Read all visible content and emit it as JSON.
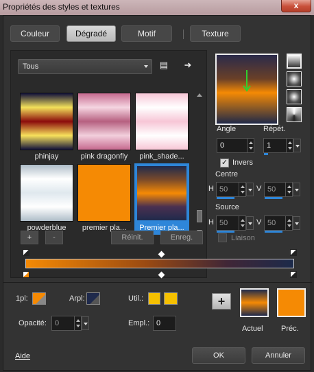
{
  "window": {
    "title": "Propriétés des styles et textures",
    "close": "x"
  },
  "tabs": [
    {
      "label": "Couleur",
      "active": false
    },
    {
      "label": "Dégradé",
      "active": true
    },
    {
      "label": "Motif",
      "active": false
    },
    {
      "label": "Texture",
      "active": false
    }
  ],
  "filter": {
    "value": "Tous"
  },
  "icons": {
    "library": "library-icon",
    "arrow": "arrow-right-icon"
  },
  "gradients": [
    {
      "name": "phinjay",
      "selected": false,
      "colors": [
        "#11113a",
        "#f3e05a",
        "#8b0b0b",
        "#f7e15c",
        "#11113a"
      ]
    },
    {
      "name": "pink dragonfly",
      "selected": false,
      "colors": [
        "#c66a8f",
        "#f5d5e1",
        "#b66080",
        "#f2cfdc",
        "#c66a8f"
      ]
    },
    {
      "name": "pink_shade...",
      "selected": false,
      "colors": [
        "#f7c6d6",
        "#ffffff",
        "#f7c6d6",
        "#ffffff",
        "#f7c6d6"
      ]
    },
    {
      "name": "powderblue",
      "selected": false,
      "colors": [
        "#aebdc8",
        "#ffffff",
        "#dfe8ee",
        "#ffffff",
        "#aebdc8"
      ]
    },
    {
      "name": "premier pla...",
      "selected": false,
      "colors": [
        "#f58a04",
        "#f58a04",
        "#f58a04",
        "#f58a04",
        "#f58a04"
      ]
    },
    {
      "name": "Premier pla...",
      "selected": true,
      "colors": [
        "#1f2a4c",
        "#7a4a2a",
        "#f58a04",
        "#4a3050",
        "#1f2a4c"
      ]
    }
  ],
  "buttons": {
    "add": "+",
    "remove": "-",
    "reset": "Réinit.",
    "save": "Enreg."
  },
  "preview": {
    "angle_label": "Angle",
    "angle": "0",
    "repeat_label": "Répét.",
    "repeat": "1",
    "invert_label": "Invers",
    "invert": true
  },
  "center": {
    "label": "Centre",
    "h_label": "H",
    "h": "50",
    "v_label": "V",
    "v": "50"
  },
  "source": {
    "label": "Source",
    "h_label": "H",
    "h": "50",
    "v_label": "V",
    "v": "50",
    "link_label": "Liaison",
    "link": false
  },
  "stops": {
    "color_label": "1pl:",
    "color": "#f58a04",
    "transp_label": "Arpl:",
    "transp_color": "#1f2a4c",
    "use_label": "Util.:",
    "use_color1": "#f5c000",
    "use_color2": "#f5c000",
    "opacity_label": "Opacité:",
    "opacity": "0",
    "location_label": "Empl.:",
    "location": "0"
  },
  "result": {
    "current_label": "Actuel",
    "previous_label": "Préc.",
    "current_colors": [
      "#1f2a4c",
      "#f58a04",
      "#1f2a4c"
    ],
    "previous_color": "#f58a04"
  },
  "footer": {
    "help": "Aide",
    "ok": "OK",
    "cancel": "Annuler"
  }
}
